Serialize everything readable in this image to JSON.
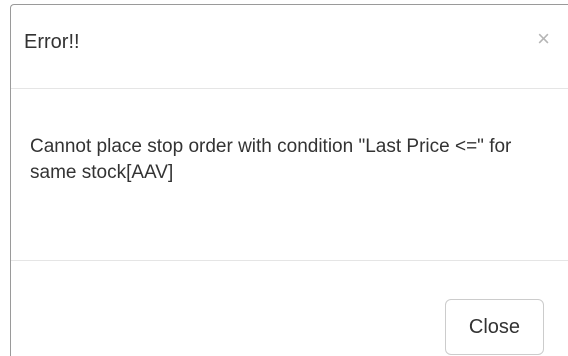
{
  "dialog": {
    "title": "Error!!",
    "close_icon": "close-icon",
    "close_glyph": "×",
    "message": "Cannot place stop order with condition \"Last Price <=\" for same stock[AAV]",
    "close_button_label": "Close"
  },
  "colors": {
    "border": "#9a9a9a",
    "divider": "#e5e5e5",
    "text": "#333333",
    "close_icon": "#b5b5b5",
    "button_border": "#cccccc"
  }
}
